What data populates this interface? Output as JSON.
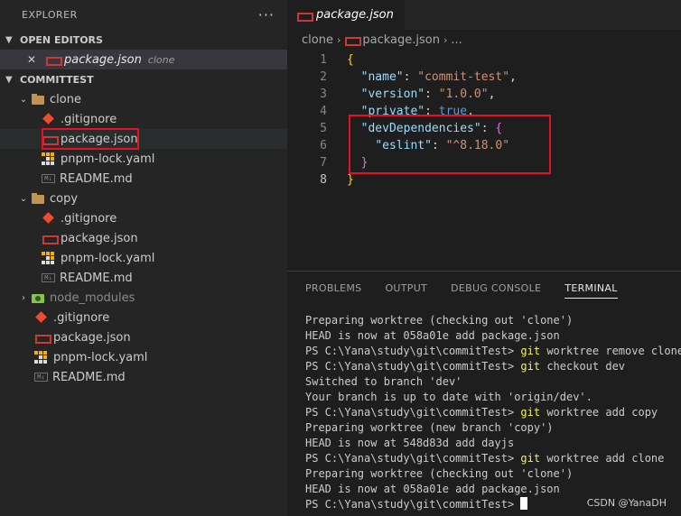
{
  "sidebar": {
    "title": "EXPLORER",
    "more": "···",
    "open_editors": {
      "title": "OPEN EDITORS",
      "items": [
        {
          "close": "✕",
          "name": "package.json",
          "desc": "clone"
        }
      ]
    },
    "workspace": {
      "title": "COMMITTEST",
      "clone": {
        "name": "clone",
        "files": [
          ".gitignore",
          "package.json",
          "pnpm-lock.yaml",
          "README.md"
        ]
      },
      "copy": {
        "name": "copy",
        "files": [
          ".gitignore",
          "package.json",
          "pnpm-lock.yaml",
          "README.md"
        ]
      },
      "node_modules": "node_modules",
      "root_files": [
        ".gitignore",
        "package.json",
        "pnpm-lock.yaml",
        "README.md"
      ]
    }
  },
  "editor": {
    "tab": "package.json",
    "breadcrumb": [
      "clone",
      "package.json",
      "..."
    ],
    "lines": {
      "n": [
        "1",
        "2",
        "3",
        "4",
        "5",
        "6",
        "7",
        "8"
      ],
      "l1": "{",
      "l2_key": "\"name\"",
      "l2_val": "\"commit-test\"",
      "l3_key": "\"version\"",
      "l3_val": "\"1.0.0\"",
      "l4_key": "\"private\"",
      "l4_val": "true",
      "l5_key": "\"devDependencies\"",
      "l5_brace": "{",
      "l6_key": "\"eslint\"",
      "l6_val": "\"^8.18.0\"",
      "l7": "}",
      "l8": "}"
    }
  },
  "panel": {
    "tabs": [
      "PROBLEMS",
      "OUTPUT",
      "DEBUG CONSOLE",
      "TERMINAL"
    ],
    "prompt": "PS C:\\Yana\\study\\git\\commitTest>",
    "git": "git",
    "t": {
      "l0": "Preparing worktree (checking out 'clone')",
      "l1": "HEAD is now at 058a01e add package.json",
      "l2": " worktree remove clone",
      "l3": " checkout dev",
      "l4": "Switched to branch 'dev'",
      "l5": "Your branch is up to date with 'origin/dev'.",
      "l6": " worktree add copy",
      "l7": "Preparing worktree (new branch 'copy')",
      "l8": "HEAD is now at 548d83d add dayjs",
      "l9": " worktree add clone",
      "l10": "Preparing worktree (checking out 'clone')",
      "l11": "HEAD is now at 058a01e add package.json"
    },
    "watermark": "CSDN @YanaDH"
  },
  "colors": {
    "highlight_box": "#e81123",
    "accent_json": "#cb3837",
    "git_icon": "#e94e32"
  }
}
